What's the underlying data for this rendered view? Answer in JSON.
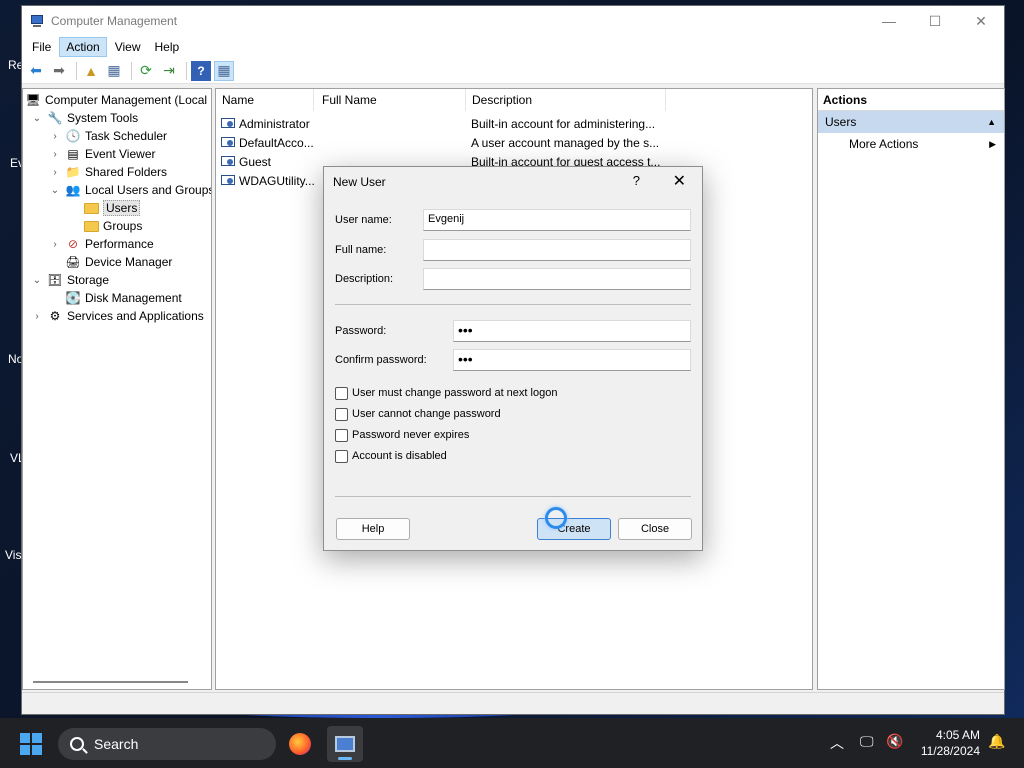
{
  "window": {
    "title": "Computer Management",
    "controls": {
      "minimize": "—",
      "maximize": "☐",
      "close": "✕"
    }
  },
  "menu": [
    "File",
    "Action",
    "View",
    "Help"
  ],
  "tree": {
    "root": "Computer Management (Local",
    "system_tools": "System Tools",
    "task_scheduler": "Task Scheduler",
    "event_viewer": "Event Viewer",
    "shared_folders": "Shared Folders",
    "local_users": "Local Users and Groups",
    "users": "Users",
    "groups": "Groups",
    "performance": "Performance",
    "device_manager": "Device Manager",
    "storage": "Storage",
    "disk_management": "Disk Management",
    "services": "Services and Applications"
  },
  "list": {
    "columns": [
      "Name",
      "Full Name",
      "Description"
    ],
    "rows": [
      {
        "name": "Administrator",
        "full": "",
        "desc": "Built-in account for administering..."
      },
      {
        "name": "DefaultAcco...",
        "full": "",
        "desc": "A user account managed by the s..."
      },
      {
        "name": "Guest",
        "full": "",
        "desc": "Built-in account for guest access t..."
      },
      {
        "name": "WDAGUtility...",
        "full": "",
        "desc": ""
      }
    ]
  },
  "actions": {
    "header": "Actions",
    "section": "Users",
    "more": "More Actions"
  },
  "dialog": {
    "title": "New User",
    "help_glyph": "?",
    "close_glyph": "✕",
    "username_label": "User name:",
    "username_value": "Evgenij",
    "fullname_label": "Full name:",
    "fullname_value": "",
    "description_label": "Description:",
    "description_value": "",
    "password_label": "Password:",
    "password_value": "•••",
    "confirm_label": "Confirm password:",
    "confirm_value": "•••",
    "checkboxes": [
      "User must change password at next logon",
      "User cannot change password",
      "Password never expires",
      "Account is disabled"
    ],
    "help_button": "Help",
    "create_button": "Create",
    "close_button": "Close"
  },
  "desktop_labels": [
    "Re",
    "Ev",
    "No",
    "VL",
    "Vis"
  ],
  "taskbar": {
    "search": "Search",
    "time": "4:05 AM",
    "date": "11/28/2024"
  },
  "colors": {
    "accent": "#0078d4",
    "selection": "#cce4f7",
    "actions_section": "#c7d9ee"
  }
}
